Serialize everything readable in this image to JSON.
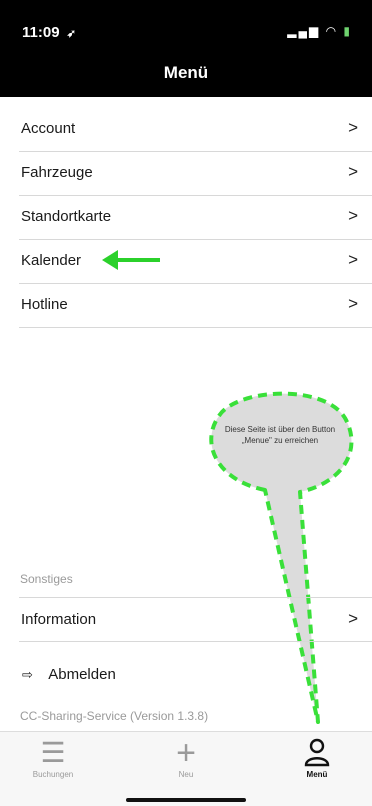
{
  "status_bar": {
    "time": "11:09",
    "location_glyph": "➶",
    "signal_glyph": "▂▄▆",
    "wifi_glyph": "◠",
    "battery_glyph": "▮"
  },
  "header": {
    "title": "Menü"
  },
  "menu": {
    "items": [
      {
        "label": "Account",
        "chevron": ">"
      },
      {
        "label": "Fahrzeuge",
        "chevron": ">"
      },
      {
        "label": "Standortkarte",
        "chevron": ">"
      },
      {
        "label": "Kalender",
        "chevron": ">"
      },
      {
        "label": "Hotline",
        "chevron": ">"
      }
    ]
  },
  "other_section": {
    "label": "Sonstiges",
    "info_label": "Information",
    "info_chevron": ">"
  },
  "logout": {
    "icon": "logout-icon",
    "icon_glyph": "⇨",
    "label": "Abmelden"
  },
  "version_text": "CC-Sharing-Service (Version 1.3.8)",
  "callout": {
    "text": "Diese Seite ist über den Button „Menue\" zu erreichen",
    "border_color": "#39e039",
    "fill_color": "#dcdcdc"
  },
  "annotation_arrow_color": "#2bd12b",
  "tabbar": {
    "tabs": [
      {
        "label": "Buchungen",
        "icon": "list-icon",
        "glyph": "☰",
        "active": false
      },
      {
        "label": "Neu",
        "icon": "plus-icon",
        "glyph": "+",
        "active": false
      },
      {
        "label": "Menü",
        "icon": "person-icon",
        "glyph": "",
        "active": true
      }
    ]
  }
}
